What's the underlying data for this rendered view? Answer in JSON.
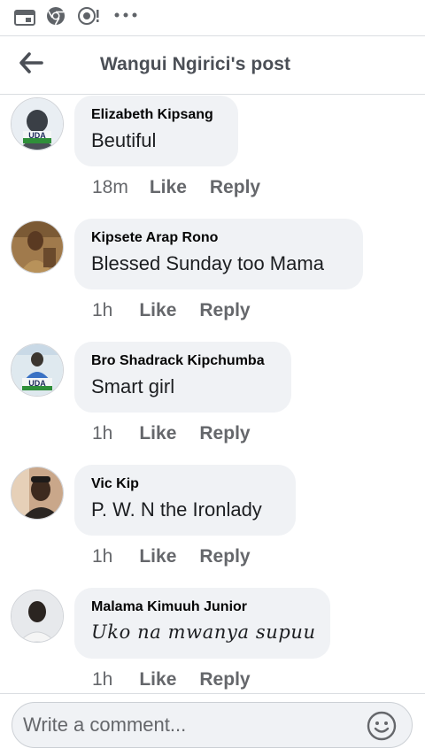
{
  "header": {
    "title": "Wangui Ngirici's post"
  },
  "comments": [
    {
      "author": "Elizabeth Kipsang",
      "text": "Beutiful",
      "time": "18m",
      "like_label": "Like",
      "reply_label": "Reply",
      "avatar_label": "UDA"
    },
    {
      "author": "Kipsete Arap Rono",
      "text": "Blessed Sunday too Mama",
      "time": "1h",
      "like_label": "Like",
      "reply_label": "Reply"
    },
    {
      "author": "Bro Shadrack Kipchumba",
      "text": "Smart girl",
      "time": "1h",
      "like_label": "Like",
      "reply_label": "Reply",
      "avatar_label": "UDA"
    },
    {
      "author": "Vic Kip",
      "text": "P. W. N the Ironlady",
      "time": "1h",
      "like_label": "Like",
      "reply_label": "Reply"
    },
    {
      "author": "Malama Kimuuh Junior",
      "text": "Uko na mwanya supuu",
      "time": "1h",
      "like_label": "Like",
      "reply_label": "Reply"
    }
  ],
  "composer": {
    "placeholder": "Write a comment..."
  },
  "colors": {
    "bubble": "#f0f2f5",
    "meta_text": "#65676b",
    "header_text": "#4b4f56"
  }
}
